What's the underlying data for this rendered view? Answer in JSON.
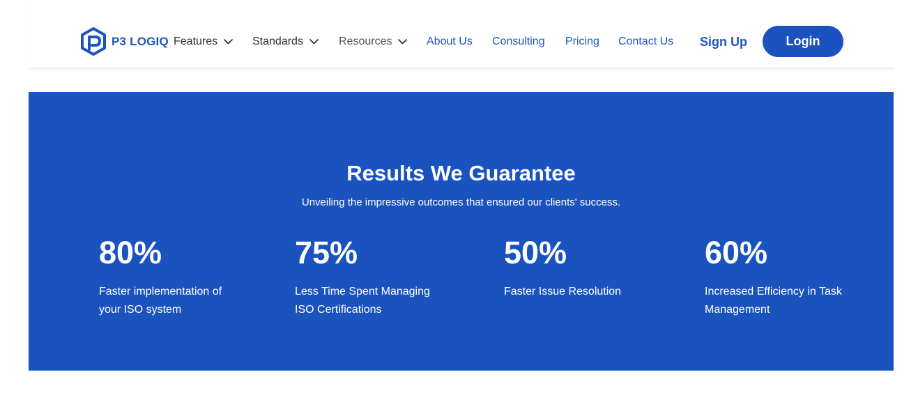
{
  "brand": {
    "name": "P3 LOGIQ",
    "color": "#1d54be"
  },
  "nav": {
    "items": [
      {
        "label": "Features",
        "has_dropdown": true
      },
      {
        "label": "Standards",
        "has_dropdown": true
      },
      {
        "label": "Resources",
        "has_dropdown": true
      },
      {
        "label": "About Us",
        "has_dropdown": false
      },
      {
        "label": "Consulting",
        "has_dropdown": false
      },
      {
        "label": "Pricing",
        "has_dropdown": false
      },
      {
        "label": "Contact Us",
        "has_dropdown": false
      }
    ],
    "signup_label": "Sign Up",
    "login_label": "Login",
    "icons": [
      "hexagon-logo-icon",
      "chevron-down-icon"
    ]
  },
  "results": {
    "title": "Results We Guarantee",
    "subtitle": "Unveiling the impressive outcomes that ensured our clients' success.",
    "background": "#1b53be",
    "stats": [
      {
        "value": "80%",
        "label": "Faster implementation of your ISO system"
      },
      {
        "value": "75%",
        "label": "Less Time Spent Managing ISO Certifications"
      },
      {
        "value": "50%",
        "label": "Faster Issue Resolution"
      },
      {
        "value": "60%",
        "label": "Increased Efficiency in Task Management"
      }
    ]
  }
}
